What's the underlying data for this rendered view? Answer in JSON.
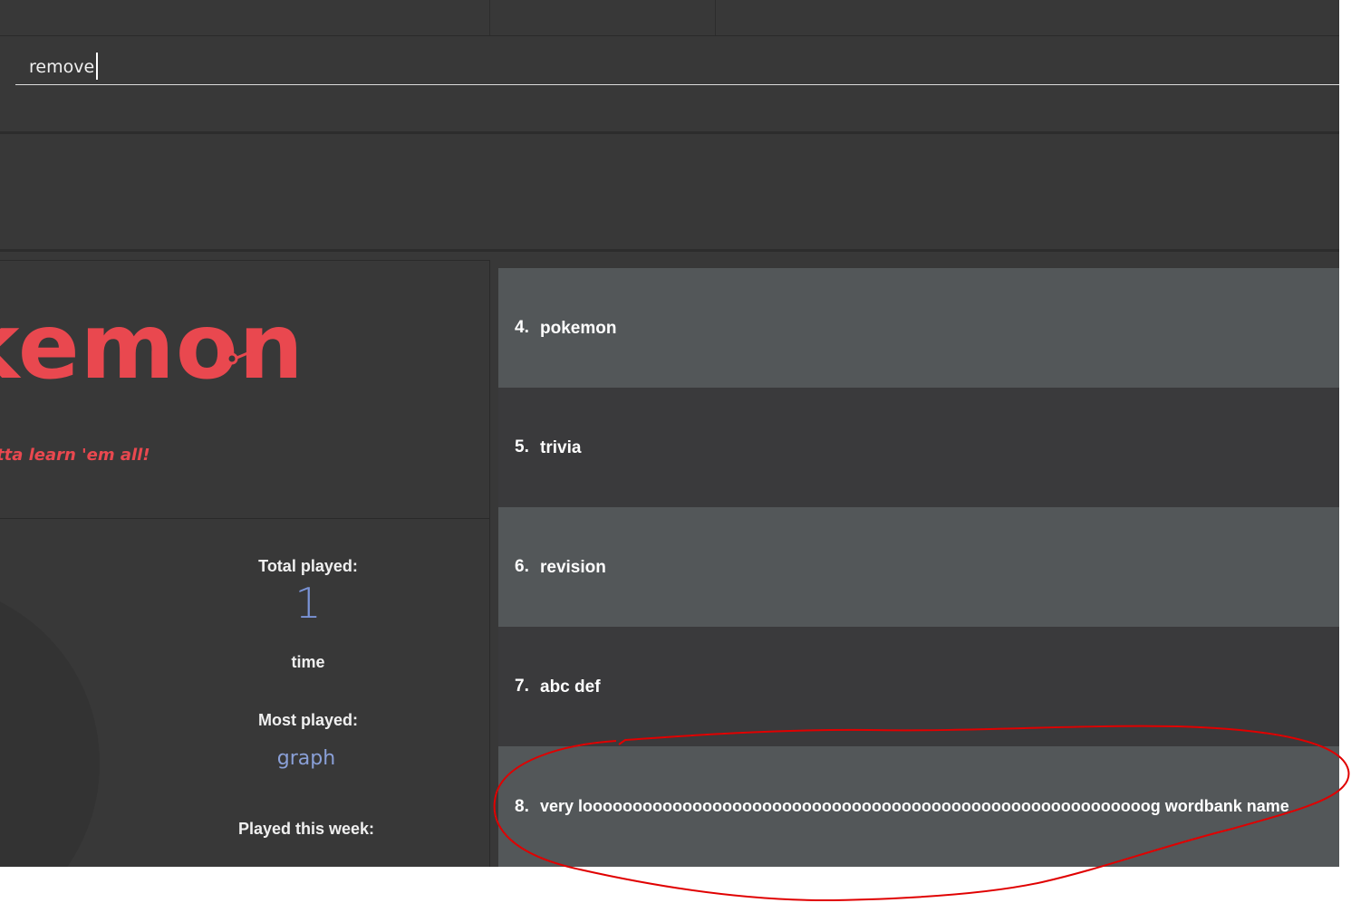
{
  "command": {
    "value": "remove"
  },
  "logo": {
    "text": "kemon",
    "slogan": "tta learn 'em all!",
    "accent_color": "#e9484f"
  },
  "stats": {
    "total_played_label": "Total played:",
    "total_played_value": "1",
    "total_played_unit": "time",
    "most_played_label": "Most played:",
    "most_played_value": "graph",
    "played_this_week_label": "Played this week:"
  },
  "wordbanks": [
    {
      "index": "4.",
      "name": "pokemon"
    },
    {
      "index": "5.",
      "name": "trivia"
    },
    {
      "index": "6.",
      "name": "revision"
    },
    {
      "index": "7.",
      "name": "abc  def"
    },
    {
      "index": "8.",
      "name": "very looooooooooooooooooooooooooooooooooooooooooooooooooooooooog wordbank name"
    }
  ],
  "annotation": {
    "shape": "circle-highlight",
    "color": "#e00000"
  }
}
